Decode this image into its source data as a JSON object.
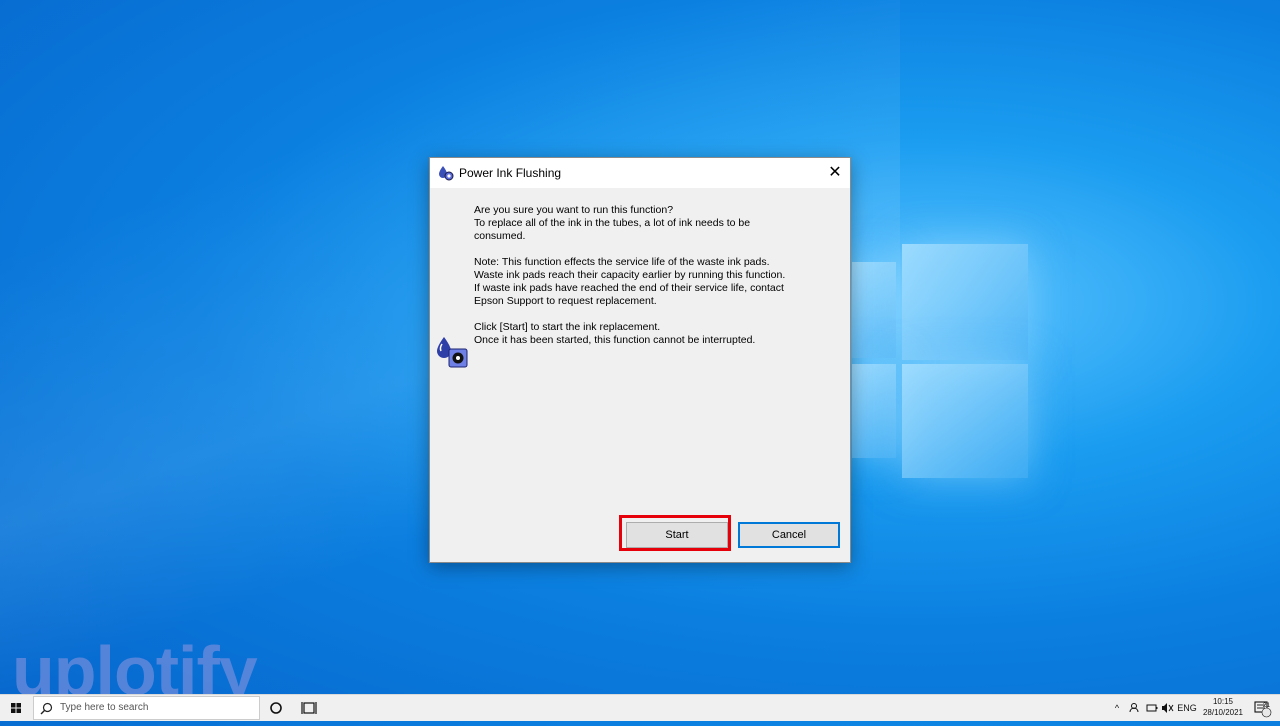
{
  "dialog": {
    "title": "Power Ink Flushing",
    "close_label": "✕",
    "lines": [
      "Are you sure you want to run this function?",
      "To replace all of the ink in the tubes, a lot of ink needs to be",
      "consumed.",
      "",
      "Note: This function effects the service life of the waste ink pads.",
      "Waste ink pads reach their capacity earlier by running this function.",
      "If waste ink pads have reached the end of their service life, contact",
      "Epson Support to request replacement.",
      "",
      "Click [Start] to start the ink replacement.",
      "Once it has been started, this function cannot be interrupted."
    ],
    "start_label": "Start",
    "cancel_label": "Cancel"
  },
  "taskbar": {
    "search_placeholder": "Type here to search",
    "tray_chevron": "^",
    "language": "ENG",
    "time": "10:15",
    "date": "28/10/2021",
    "notification_count": "21"
  },
  "watermark": {
    "text": "uplotify"
  },
  "colors": {
    "highlight": "#e6000a",
    "focus_border": "#0078d7",
    "desktop_blue": "#0b7fe0"
  },
  "icons": {
    "title": "ink-drop-gear-icon",
    "dialog": "ink-drop-gear-icon",
    "start_menu": "windows-logo-icon",
    "search": "search-icon",
    "cortana": "cortana-circle-icon",
    "taskview": "task-view-icon",
    "close": "close-icon"
  }
}
